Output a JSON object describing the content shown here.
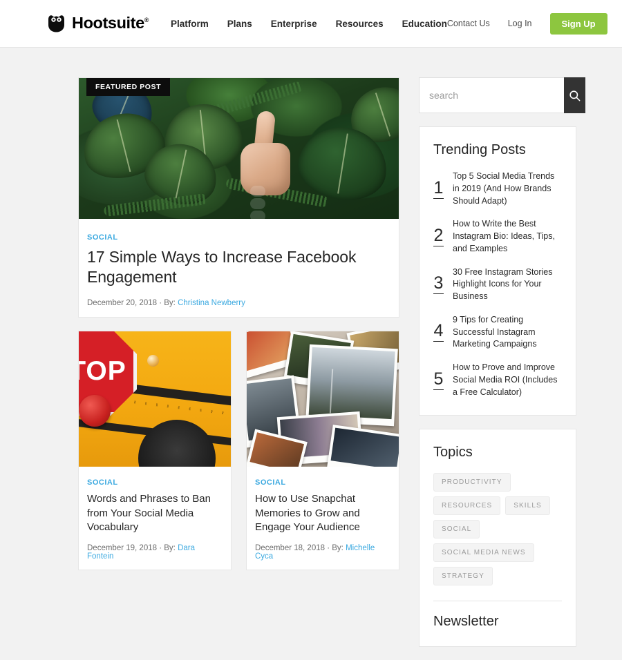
{
  "header": {
    "brand": {
      "name": "Hootsuite",
      "registered": "®",
      "logo_icon": "owl-icon"
    },
    "nav": [
      {
        "label": "Platform"
      },
      {
        "label": "Plans"
      },
      {
        "label": "Enterprise"
      },
      {
        "label": "Resources"
      },
      {
        "label": "Education"
      }
    ],
    "utility": [
      {
        "label": "Contact Us"
      },
      {
        "label": "Log In"
      }
    ],
    "signup_label": "Sign Up",
    "signup_color": "#8dc63f"
  },
  "featured": {
    "badge": "FEATURED POST",
    "category": "SOCIAL",
    "title": "17 Simple Ways to Increase Facebook Engagement",
    "date": "December 20, 2018",
    "by_label": "By:",
    "author": "Christina Newberry",
    "separator": "·",
    "image_alt": "hand giving thumbs up among tropical green leaves"
  },
  "posts": [
    {
      "category": "SOCIAL",
      "title": "Words and Phrases to Ban from Your Social Media Vocabulary",
      "date": "December 19, 2018",
      "by_label": "By:",
      "author": "Dara Fontein",
      "separator": "·",
      "image_alt": "close up of yellow school bus with red stop sign",
      "stop_text": "STOP"
    },
    {
      "category": "SOCIAL",
      "title": "How to Use Snapchat Memories to Grow and Engage Your Audience",
      "date": "December 18, 2018",
      "by_label": "By:",
      "author": "Michelle Cyca",
      "separator": "·",
      "image_alt": "pile of scattered printed photographs"
    }
  ],
  "search": {
    "placeholder": "search",
    "value": "",
    "button_icon": "search-icon",
    "button_color": "#333333"
  },
  "trending": {
    "title": "Trending Posts",
    "items": [
      {
        "rank": "1",
        "title": "Top 5 Social Media Trends in 2019 (And How Brands Should Adapt)"
      },
      {
        "rank": "2",
        "title": "How to Write the Best Instagram Bio: Ideas, Tips, and Examples"
      },
      {
        "rank": "3",
        "title": "30 Free Instagram Stories Highlight Icons for Your Business"
      },
      {
        "rank": "4",
        "title": "9 Tips for Creating Successful Instagram Marketing Campaigns"
      },
      {
        "rank": "5",
        "title": "How to Prove and Improve Social Media ROI (Includes a Free Calculator)"
      }
    ]
  },
  "topics": {
    "title": "Topics",
    "tags": [
      {
        "label": "PRODUCTIVITY"
      },
      {
        "label": "RESOURCES"
      },
      {
        "label": "SKILLS"
      },
      {
        "label": "SOCIAL"
      },
      {
        "label": "SOCIAL MEDIA NEWS"
      },
      {
        "label": "STRATEGY"
      }
    ],
    "next_section_title": "Newsletter"
  },
  "accents": {
    "link_blue": "#3ba9e0",
    "page_bg": "#f2f2f2",
    "card_border": "#e6e6e6"
  }
}
